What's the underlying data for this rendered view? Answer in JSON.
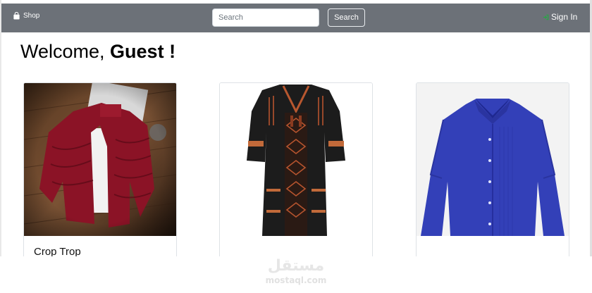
{
  "navbar": {
    "brand_label": "Shop",
    "brand_icon": "shopping-bag-icon",
    "search_placeholder": "Search",
    "search_value": "",
    "search_button_label": "Search",
    "signin_label": "Sign In",
    "signin_icon": "sign-in-icon",
    "background_color": "#6c7178",
    "signin_icon_color": "#28a745"
  },
  "welcome": {
    "prefix": "Welcome, ",
    "name": "Guest !"
  },
  "products": [
    {
      "title": "Crop Trop",
      "image": "red-puffer-jacket-photo"
    },
    {
      "title": "",
      "image": "black-embroidered-dress-photo"
    },
    {
      "title": "",
      "image": "blue-dress-shirt-photo"
    }
  ],
  "watermark": {
    "arabic": "مستقل",
    "latin": "mostaql.com"
  }
}
